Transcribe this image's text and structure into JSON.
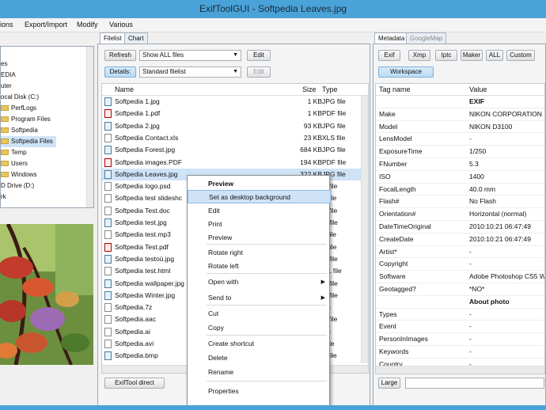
{
  "window": {
    "title": "ExifToolGUI - Softpedia Leaves.jpg"
  },
  "menu": [
    "ions",
    "Export/Import",
    "Modify",
    "Various"
  ],
  "tree": {
    "items": [
      "es",
      "EDIA",
      "uter",
      "ocal Disk (C:)",
      "PerfLogs",
      "Program Files",
      "Softpedia",
      "Softpedia Files",
      "Temp",
      "Users",
      "Windows",
      "D Drive (D:)",
      "rk"
    ]
  },
  "filelist": {
    "tabs": [
      "Filelist",
      "Chart"
    ],
    "refresh_label": "Refresh",
    "filter_value": "Show ALL files",
    "edit_label": "Edit",
    "details_label": "Details:",
    "view_value": "Standard filelist",
    "edit2_label": "Edit",
    "columns": {
      "name": "Name",
      "size": "Size",
      "type": "Type"
    },
    "rows": [
      {
        "name": "Softpedia 1.jpg",
        "size": "1 KB",
        "type": "JPG file",
        "icon": "img"
      },
      {
        "name": "Softpedia 1.pdf",
        "size": "1 KB",
        "type": "PDF file",
        "icon": "pdf"
      },
      {
        "name": "Softpedia 2.jpg",
        "size": "93 KB",
        "type": "JPG file",
        "icon": "img"
      },
      {
        "name": "Softpedia Contact.xls",
        "size": "23 KB",
        "type": "XLS file",
        "icon": "doc"
      },
      {
        "name": "Softpedia Forest.jpg",
        "size": "684 KB",
        "type": "JPG file",
        "icon": "img"
      },
      {
        "name": "Softpedia images.PDF",
        "size": "194 KB",
        "type": "PDF file",
        "icon": "pdf"
      },
      {
        "name": "Softpedia Leaves.jpg",
        "size": "322 KB",
        "type": "JPG file",
        "icon": "img"
      },
      {
        "name": "Softpedia logo.psd",
        "size": "",
        "type": "D file",
        "icon": "doc"
      },
      {
        "name": "Softpedia test slideshc",
        "size": "",
        "type": "T file",
        "icon": "doc"
      },
      {
        "name": "Softpedia Test.doc",
        "size": "",
        "type": "C file",
        "icon": "doc"
      },
      {
        "name": "Softpedia test.jpg",
        "size": "",
        "type": "G file",
        "icon": "img"
      },
      {
        "name": "Softpedia test.mp3",
        "size": "",
        "type": "3 file",
        "icon": "doc"
      },
      {
        "name": "Softpedia Test.pdf",
        "size": "",
        "type": "F file",
        "icon": "pdf"
      },
      {
        "name": "Softpedia testoü.jpg",
        "size": "",
        "type": "G file",
        "icon": "img"
      },
      {
        "name": "Softpedia test.html",
        "size": "",
        "type": "ML file",
        "icon": "doc"
      },
      {
        "name": "Softpedia wallpaper.jpg",
        "size": "",
        "type": "G file",
        "icon": "img"
      },
      {
        "name": "Softpedia Winter.jpg",
        "size": "",
        "type": "G file",
        "icon": "img"
      },
      {
        "name": "Softpedia.7z",
        "size": "",
        "type": "file",
        "icon": "doc"
      },
      {
        "name": "Softpedia.aac",
        "size": "",
        "type": "C file",
        "icon": "doc"
      },
      {
        "name": "Softpedia.ai",
        "size": "",
        "type": "file",
        "icon": "doc"
      },
      {
        "name": "Softpedia.avi",
        "size": "",
        "type": "I file",
        "icon": "doc"
      },
      {
        "name": "Softpedia.bmp",
        "size": "",
        "type": "P file",
        "icon": "img"
      }
    ],
    "exiftool_direct_label": "ExifTool direct"
  },
  "context_menu": {
    "items": [
      {
        "label": "Preview",
        "bold": true
      },
      {
        "label": "Set as desktop background",
        "highlight": true
      },
      {
        "label": "Edit"
      },
      {
        "label": "Print"
      },
      {
        "label": "Preview"
      },
      {
        "label": "Rotate right"
      },
      {
        "label": "Rotate left"
      },
      {
        "label": "Open with",
        "submenu": true
      },
      {
        "label": "Send to",
        "submenu": true
      },
      {
        "label": "Cut"
      },
      {
        "label": "Copy"
      },
      {
        "label": "Create shortcut"
      },
      {
        "label": "Delete"
      },
      {
        "label": "Rename"
      },
      {
        "label": "Properties"
      }
    ],
    "submenu_glyph": "▶"
  },
  "metadata": {
    "tabs": [
      "Metadata",
      "GoogleMap"
    ],
    "buttons": [
      "Exif",
      "Xmp",
      "Iptc",
      "Maker",
      "ALL",
      "Custom"
    ],
    "workspace_label": "Workspace",
    "col_tag": "Tag name",
    "col_value": "Value",
    "rows": [
      {
        "tag": "",
        "value": "EXIF",
        "bold": true
      },
      {
        "tag": "Make",
        "value": "NIKON CORPORATION"
      },
      {
        "tag": "Model",
        "value": "NIKON D3100"
      },
      {
        "tag": "LensModel",
        "value": "-"
      },
      {
        "tag": "ExposureTime",
        "value": "1/250"
      },
      {
        "tag": "FNumber",
        "value": "5.3"
      },
      {
        "tag": "ISO",
        "value": "1400"
      },
      {
        "tag": "FocalLength",
        "value": "40.0 mm"
      },
      {
        "tag": "Flash#",
        "value": "No Flash"
      },
      {
        "tag": "Orientation#",
        "value": "Horizontal (normal)"
      },
      {
        "tag": "DateTimeOriginal",
        "value": "2010:10:21 06:47:49"
      },
      {
        "tag": "CreateDate",
        "value": "2010:10:21 06:47:49"
      },
      {
        "tag": "Artist*",
        "value": "-"
      },
      {
        "tag": "Copyright",
        "value": "-"
      },
      {
        "tag": "Software",
        "value": "Adobe Photoshop CS5 W"
      },
      {
        "tag": "Geotagged?",
        "value": "*NO*"
      },
      {
        "tag": "",
        "value": "About photo",
        "bold": true
      },
      {
        "tag": "Types",
        "value": "-"
      },
      {
        "tag": "Event",
        "value": "-"
      },
      {
        "tag": "PersonInImages",
        "value": "-"
      },
      {
        "tag": "Keywords",
        "value": "-"
      },
      {
        "tag": "Country",
        "value": "-"
      }
    ],
    "large_label": "Large"
  },
  "colors": {
    "title_bar": "#4aa3d8",
    "selection": "#cfe3f7",
    "folder": "#e8c65c"
  }
}
